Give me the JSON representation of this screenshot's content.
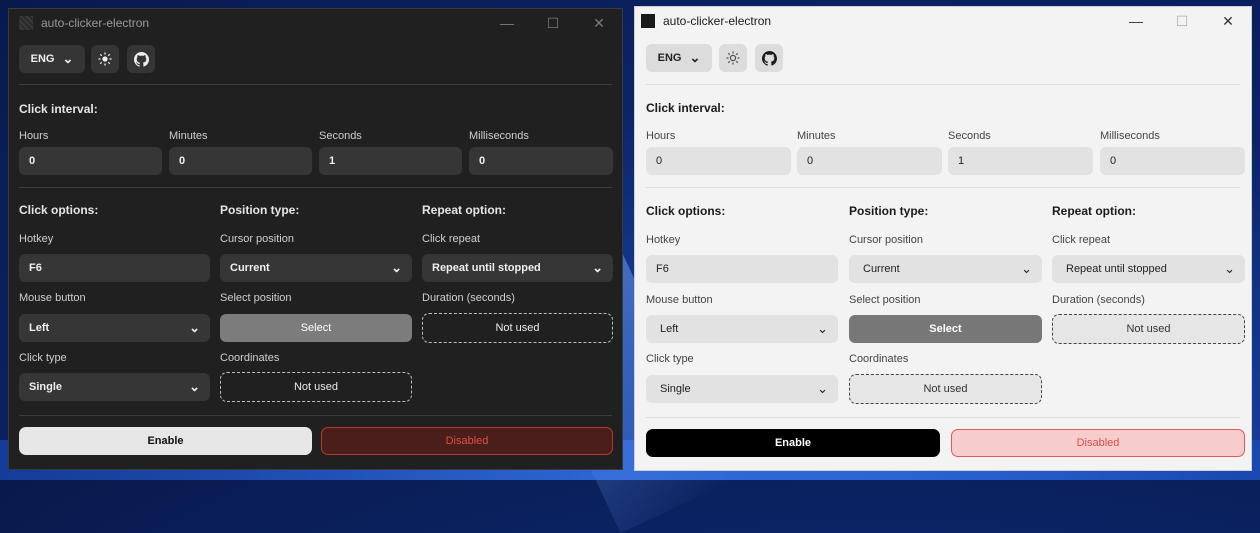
{
  "app": {
    "title": "auto-clicker-electron"
  },
  "window_controls": {
    "minimize": "—",
    "maximize": "☐",
    "close": "✕"
  },
  "topbar": {
    "language": "ENG",
    "theme_icon": "sun-icon",
    "github_icon": "github-icon"
  },
  "interval": {
    "title": "Click interval:",
    "fields": [
      {
        "label": "Hours",
        "value": "0"
      },
      {
        "label": "Minutes",
        "value": "0"
      },
      {
        "label": "Seconds",
        "value": "1"
      },
      {
        "label": "Milliseconds",
        "value": "0"
      }
    ]
  },
  "options": {
    "click_title": "Click options:",
    "position_title": "Position type:",
    "repeat_title": "Repeat option:",
    "hotkey": {
      "label": "Hotkey",
      "value": "F6"
    },
    "mouse_button": {
      "label": "Mouse button",
      "value": "Left"
    },
    "click_type": {
      "label": "Click type",
      "value": "Single"
    },
    "cursor_position": {
      "label": "Cursor position",
      "value": "Current"
    },
    "select_position": {
      "label": "Select position",
      "button": "Select"
    },
    "coordinates": {
      "label": "Coordinates",
      "value": "Not used"
    },
    "click_repeat": {
      "label": "Click repeat",
      "value": "Repeat until stopped"
    },
    "duration": {
      "label": "Duration (seconds)",
      "value": "Not used"
    }
  },
  "actions": {
    "enable": "Enable",
    "disabled": "Disabled"
  },
  "themes": {
    "dark_bg": "#202020",
    "light_bg": "#f3f3f3",
    "danger": "#e04b46"
  }
}
